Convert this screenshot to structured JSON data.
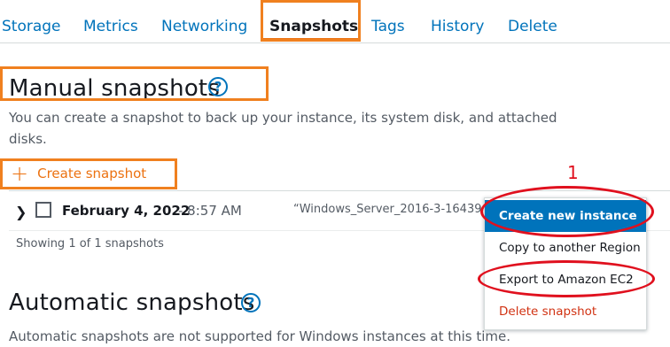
{
  "tabs": [
    {
      "label": "Storage"
    },
    {
      "label": "Metrics"
    },
    {
      "label": "Networking"
    },
    {
      "label": "Snapshots"
    },
    {
      "label": "Tags"
    },
    {
      "label": "History"
    },
    {
      "label": "Delete"
    }
  ],
  "active_tab": "Snapshots",
  "manual": {
    "title": "Manual snapshots",
    "help_symbol": "?",
    "description_line1": "You can create a snapshot to back up your instance, its system disk, and attached",
    "description_line2": "disks.",
    "create_label": "Create snapshot"
  },
  "snapshot": {
    "date": "February 4, 2022",
    "time": "- 8:57 AM",
    "description": "“Windows_Server_2016-3-16439"
  },
  "showing_text": "Showing 1 of 1 snapshots",
  "automatic": {
    "title": "Automatic snapshots",
    "help_symbol": "?",
    "description": "Automatic snapshots are not supported for Windows instances at this time."
  },
  "menu": {
    "items": [
      {
        "label": "Create new instance"
      },
      {
        "label": "Copy to another Region"
      },
      {
        "label": "Export to Amazon EC2"
      },
      {
        "label": "Delete snapshot"
      }
    ]
  },
  "annotation": {
    "step_number": "1"
  },
  "colors": {
    "link": "#0073bb",
    "orange_action": "#ec7211",
    "highlight_box": "#f0801f",
    "annotation_red": "#e0101e",
    "danger": "#d13212"
  }
}
